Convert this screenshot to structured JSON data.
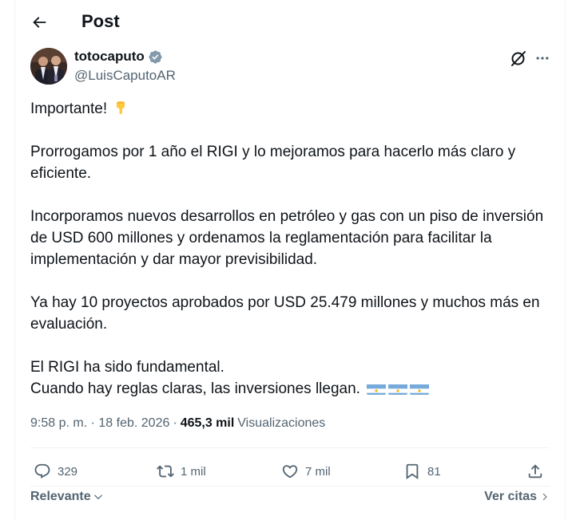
{
  "header": {
    "title": "Post",
    "back_icon": "arrow-left-icon"
  },
  "author": {
    "display_name": "totocaputo",
    "handle": "@LuisCaputoAR",
    "verified_color": "#829aab"
  },
  "tweet": {
    "paragraphs": [
      "Importante! ",
      "Prorrogamos por 1 año el RIGI y lo mejoramos para hacerlo más claro y eficiente.",
      "Incorporamos nuevos desarrollos en petróleo y gas con un piso de inversión de USD 600 millones y ordenamos la reglamentación para facilitar la implementación y dar mayor previsibilidad.",
      "Ya hay 10 proyectos aprobados por USD 25.479 millones y muchos más en evaluación.",
      "El RIGI ha sido fundamental.",
      "Cuando hay reglas claras, las inversiones llegan. "
    ]
  },
  "meta": {
    "time": "9:58 p. m.",
    "separator": "·",
    "date": "18 feb. 2026",
    "views_count": "465,3 mil",
    "views_label": "Visualizaciones"
  },
  "actions": {
    "replies": "329",
    "reposts": "1 mil",
    "likes": "7 mil",
    "bookmarks": "81"
  },
  "footer": {
    "sort_label": "Relevante",
    "quotes_link": "Ver citas"
  },
  "colors": {
    "text": "#0f1419",
    "secondary": "#536471",
    "border": "#eff3f4",
    "flag_blue": "#75aadb",
    "flag_sun": "#f6b40e"
  }
}
